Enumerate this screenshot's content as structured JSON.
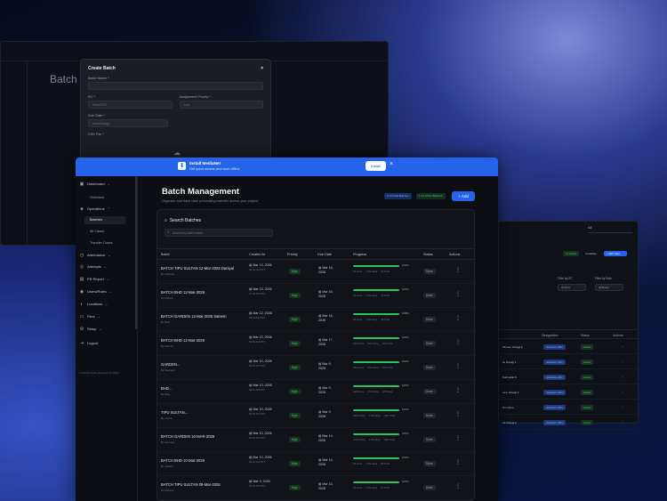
{
  "bg_left": {
    "title": "Batch M"
  },
  "modal": {
    "title": "Create Batch",
    "close": "×",
    "batch_name_label": "Batch Name *",
    "rc_label": "RC *",
    "rc_placeholder": "Select RC",
    "priority_label": "Assignment Priority *",
    "priority_value": "Low",
    "due_label": "Due Date *",
    "due_placeholder": "dd/mm/yyyy",
    "csv_label": "CSV File *"
  },
  "right_window": {
    "select_value": "All",
    "chip_green": "17 Active",
    "chip_white": "4 Inactive",
    "chip_blue": "+ Add User",
    "filter_rc": "Filter by RC",
    "filter_role": "Filter by Role",
    "filter_rc_value": "All RCs",
    "filter_role_value": "All Roles",
    "headers": [
      "Designation",
      "Status",
      "Actions"
    ],
    "rows": [
      {
        "name": "Muneer Orangi 2",
        "designation": "Assistant (RC)",
        "status": "Active"
      },
      {
        "name": "ali Orangi 1",
        "designation": "Assistant (RC)",
        "status": "Active"
      },
      {
        "name": "Kulti jabar 3",
        "designation": "Assistant (RC)",
        "status": "Active"
      },
      {
        "name": "neer Orangi 3",
        "designation": "Assistant (RC)",
        "status": "Active"
      },
      {
        "name": "Nm Nimu",
        "designation": "Assistant (RC)",
        "status": "Active"
      },
      {
        "name": "Ali Orangi 2",
        "designation": "Assistant (RC)",
        "status": "Active"
      }
    ]
  },
  "install": {
    "title": "Install MediaNet",
    "subtitle": "Get quick access and work offline",
    "button": "Install",
    "close": "×"
  },
  "sidebar": {
    "items": [
      {
        "label": "Dashboard",
        "icon": "▣",
        "chev": "⌄"
      },
      {
        "label": "Overview",
        "sub": true
      },
      {
        "label": "Operations",
        "icon": "◈",
        "chev": "⌃"
      },
      {
        "label": "Batches",
        "sub": true,
        "active": true
      },
      {
        "label": "All Cases",
        "sub": true
      },
      {
        "label": "Transfer Cases",
        "sub": true
      },
      {
        "label": "Attendance",
        "icon": "◷",
        "chev": "⌄"
      },
      {
        "label": "Attempts",
        "icon": "◎",
        "chev": "⌄"
      },
      {
        "label": "PR Report",
        "icon": "▤",
        "chev": "⌄"
      },
      {
        "label": "Users/Roles",
        "icon": "◉",
        "chev": "⌄"
      },
      {
        "label": "Locations",
        "icon": "◐",
        "chev": "⌄"
      },
      {
        "label": "Files",
        "icon": "▭",
        "chev": "⌄"
      },
      {
        "label": "Setup",
        "icon": "⚙",
        "chev": "⌄"
      },
      {
        "label": "Logout",
        "icon": "⇥"
      }
    ],
    "copyright": "© 2026 All Rights Reserved by MapIT"
  },
  "page": {
    "title": "Batch Management",
    "subtitle": "Organize and track case processing batches across your project",
    "badge_blue": "● 10 Total Batches",
    "badge_green": "● 10 Active Batches",
    "add": "+ Add"
  },
  "search": {
    "label": "Search Batches",
    "placeholder": "Search by batch name..."
  },
  "table": {
    "headers": {
      "batch": "Batch",
      "created": "Created At",
      "priority": "Priority",
      "due": "Due Date",
      "progress": "Progress",
      "status": "Status",
      "actions": "Actions"
    },
    "rows": [
      {
        "batch": "BATCH TIPU SULTAN 12-Mar-2026 Daniyal",
        "by": "By Melissa",
        "created": "Mar 13, 2026",
        "time": "08:02 AM PST",
        "priority": "High",
        "due": "Mar 15, 2026",
        "progress": 100,
        "pct": "100%",
        "stats": [
          "12 Done",
          "0 Pending",
          "21 Total"
        ],
        "status": "Done"
      },
      {
        "batch": "BATCH BHD 12-Mar-2026",
        "by": "By Mohsin",
        "created": "Mar 13, 2026",
        "time": "07:06 AM PST",
        "priority": "High",
        "due": "Mar 15, 2026",
        "progress": 100,
        "pct": "100%",
        "stats": [
          "41 Done",
          "0 Pending",
          "41 Total"
        ],
        "status": "Done"
      },
      {
        "batch": "BATCH GARDEN 12-Mar-2026 Saleem",
        "by": "By Bilal",
        "created": "Mar 12, 2026",
        "time": "06:23 AM PST",
        "priority": "High",
        "due": "Mar 16, 2026",
        "progress": 100,
        "pct": "100%",
        "stats": [
          "28 Done",
          "0 Pending",
          "28 Total"
        ],
        "status": "Done"
      },
      {
        "batch": "BATCH BHD 12-Mar-2026",
        "by": "By Munira",
        "created": "Mar 12, 2026",
        "time": "09:52 AM PST",
        "priority": "High",
        "due": "Mar 17, 2026",
        "progress": 100,
        "pct": "100%",
        "stats": [
          "103 Done",
          "0 Pending",
          "103 Total"
        ],
        "status": "Done"
      },
      {
        "batch": "GARDEN...",
        "by": "By Jannatbi",
        "created": "Mar 10, 2026",
        "time": "09:06 AM PST",
        "priority": "High",
        "due": "Mar 9, 2026",
        "progress": 100,
        "pct": "100%",
        "stats": [
          "163 Done",
          "0 Pending",
          "163 Total"
        ],
        "status": "Done"
      },
      {
        "batch": "BHD...",
        "by": "By Baig",
        "created": "Mar 10, 2026",
        "time": "09:51 AM PST",
        "priority": "High",
        "due": "Mar 9, 2026",
        "progress": 100,
        "pct": "100%",
        "stats": [
          "228 Done",
          "0 Pending",
          "228 Total"
        ],
        "status": "Done"
      },
      {
        "batch": "TIPU SULTAN...",
        "by": "By Huma",
        "created": "Mar 10, 2026",
        "time": "09:55 AM PST",
        "priority": "High",
        "due": "Mar 9, 2026",
        "progress": 100,
        "pct": "100%",
        "stats": [
          "1000 Done",
          "0 Pending",
          "1000 Total"
        ],
        "status": "Done"
      },
      {
        "batch": "BATCH GARDEN 10-MAR-2026",
        "by": "By Humera",
        "created": "Mar 10, 2026",
        "time": "09:30 AM PST",
        "priority": "High",
        "due": "Mar 14, 2026",
        "progress": 100,
        "pct": "100%",
        "stats": [
          "1000 Done",
          "0 Pending",
          "1000 Total"
        ],
        "status": "Done"
      },
      {
        "batch": "BATCH BHD 10-Mar-2026",
        "by": "By Jawad",
        "created": "Mar 10, 2026",
        "time": "09:23 AM PST",
        "priority": "High",
        "due": "Mar 14, 2026",
        "progress": 100,
        "pct": "100%",
        "stats": [
          "53 Done",
          "0 Pending",
          "53 Total"
        ],
        "status": "Done"
      },
      {
        "batch": "BATCH TIPU SULTAN 09-Mar-2026",
        "by": "By Melissa",
        "created": "Mar 9, 2026",
        "time": "09:00 AM PST",
        "priority": "High",
        "due": "Mar 13, 2026",
        "progress": 100,
        "pct": "100%",
        "stats": [
          "61 Done",
          "0 Pending",
          "61 Total"
        ],
        "status": "Done"
      }
    ]
  }
}
